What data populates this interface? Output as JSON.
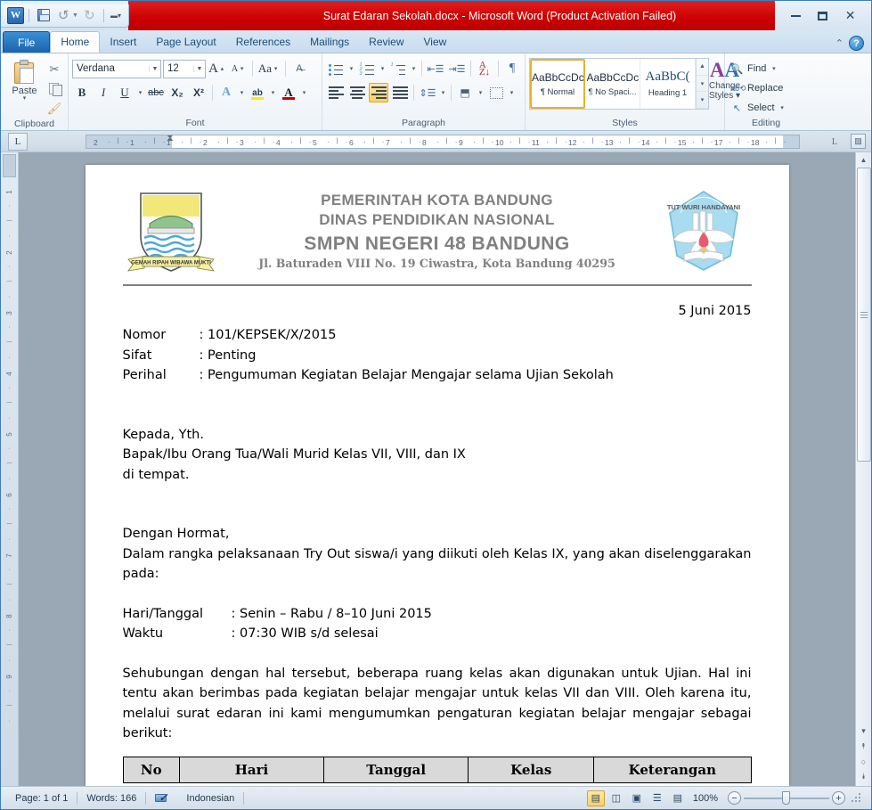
{
  "window": {
    "title": "Surat Edaran Sekolah.docx  -  Microsoft Word (Product Activation Failed)",
    "app_logo": "W",
    "controls": {
      "minimize": "minimize-icon",
      "maximize": "maximize-icon",
      "close": "✕"
    }
  },
  "quick_access": {
    "items": [
      {
        "name": "save-icon",
        "label": "Save"
      },
      {
        "name": "undo-icon",
        "label": "↺"
      },
      {
        "name": "redo-icon",
        "label": "↻"
      },
      {
        "name": "customize-qat-icon",
        "label": "▾"
      }
    ]
  },
  "tabs": [
    {
      "label": "File",
      "active": false,
      "file": true
    },
    {
      "label": "Home",
      "active": true
    },
    {
      "label": "Insert",
      "active": false
    },
    {
      "label": "Page Layout",
      "active": false
    },
    {
      "label": "References",
      "active": false
    },
    {
      "label": "Mailings",
      "active": false
    },
    {
      "label": "Review",
      "active": false
    },
    {
      "label": "View",
      "active": false
    }
  ],
  "tabbar_right": {
    "minimize_ribbon": "⌃",
    "help": "?"
  },
  "ribbon": {
    "clipboard": {
      "label": "Clipboard",
      "paste": "Paste",
      "paste_arrow": "▾",
      "cut": "✂",
      "copy": "copy-icon",
      "format_painter": "🖌",
      "launcher": "⌍"
    },
    "font": {
      "label": "Font",
      "font_name": "Verdana",
      "font_size": "12",
      "grow_font": "A",
      "shrink_font": "A",
      "change_case": "Aa",
      "clear_formatting": "clear-formatting-icon",
      "bold": "B",
      "italic": "I",
      "underline": "U",
      "strikethrough": "abc",
      "subscript": "X₂",
      "superscript": "X²",
      "text_effects": "A",
      "highlight": "ab",
      "font_color": "A",
      "launcher": "⌍"
    },
    "paragraph": {
      "label": "Paragraph",
      "bullets": "bullets-icon",
      "numbering": "numbering-icon",
      "multilevel": "multilevel-list-icon",
      "decrease_indent": "decrease-indent-icon",
      "increase_indent": "increase-indent-icon",
      "sort": "sort-icon",
      "show_marks": "¶",
      "align_left": "align-left-icon",
      "align_center": "align-center-icon",
      "align_right": "align-right-icon",
      "justify": "justify-icon",
      "line_spacing": "line-spacing-icon",
      "shading": "shading-icon",
      "borders": "borders-icon",
      "launcher": "⌍"
    },
    "styles": {
      "label": "Styles",
      "items": [
        {
          "preview": "AaBbCcDc",
          "name": "¶ Normal",
          "selected": true
        },
        {
          "preview": "AaBbCcDc",
          "name": "¶ No Spaci...",
          "selected": false
        },
        {
          "preview": "AaBbC(",
          "name": "Heading 1",
          "selected": false
        }
      ],
      "scroll_up": "▲",
      "scroll_down": "▾",
      "more": "▾",
      "change_styles": "Change",
      "change_styles2": "Styles ▾",
      "launcher": "⌍"
    },
    "editing": {
      "label": "Editing",
      "find": "Find",
      "find_arrow": "▾",
      "replace": "Replace",
      "select": "Select",
      "select_arrow": "▾"
    }
  },
  "ruler": {
    "tab_selector": "L",
    "horizontal_marks": [
      "2",
      "1",
      "1",
      "2",
      "3",
      "4",
      "5",
      "6",
      "7",
      "8",
      "9",
      "10",
      "11",
      "12",
      "13",
      "14",
      "15",
      "17",
      "18"
    ],
    "vertical_marks": [
      "1",
      "2",
      "3",
      "4",
      "5",
      "6",
      "7",
      "8",
      "9"
    ],
    "right_tab_icon": "L",
    "far_icon": "select-browse-object-icon"
  },
  "document": {
    "letterhead": {
      "logo_left": "bandung-city-seal-logo",
      "logo_left_motto": "GEMAH RIPAH WIBAWA MUKTI",
      "logo_right": "tut-wuri-handayani-logo",
      "logo_right_text": "TUT WURI HANDAYANI",
      "line1": "PEMERINTAH KOTA BANDUNG",
      "line2": "DINAS PENDIDIKAN NASIONAL",
      "line3": "SMPN NEGERI 48 BANDUNG",
      "line4": "Jl. Baturaden VIII No. 19 Ciwastra, Kota Bandung 40295"
    },
    "date": "5 Juni 2015",
    "fields": [
      {
        "key": "Nomor",
        "value": ": 101/KEPSEK/X/2015"
      },
      {
        "key": "Sifat",
        "value": ": Penting"
      },
      {
        "key": "Perihal",
        "value": ": Pengumuman Kegiatan Belajar Mengajar selama Ujian Sekolah"
      }
    ],
    "addressee": [
      "Kepada, Yth.",
      "Bapak/Ibu Orang Tua/Wali Murid Kelas VII, VIII, dan IX",
      "di tempat."
    ],
    "salutation": "Dengan Hormat,",
    "body1": "Dalam rangka pelaksanaan Try Out siswa/i yang diikuti oleh Kelas IX, yang akan diselenggarakan pada:",
    "details": [
      {
        "key": "Hari/Tanggal",
        "value": ": Senin – Rabu / 8–10 Juni 2015"
      },
      {
        "key": "Waktu",
        "value": ": 07:30 WIB s/d selesai"
      }
    ],
    "body2": "Sehubungan dengan hal tersebut, beberapa ruang kelas akan digunakan untuk Ujian. Hal ini tentu akan berimbas pada kegiatan belajar mengajar untuk kelas VII dan VIII. Oleh karena itu, melalui surat edaran ini kami mengumumkan pengaturan kegiatan belajar mengajar sebagai berikut:",
    "table": {
      "headers": [
        "No",
        "Hari",
        "Tanggal",
        "Kelas",
        "Keterangan"
      ]
    }
  },
  "scrollbar": {
    "up": "▲",
    "down": "▾",
    "prev_page": "⯭",
    "browse_object": "○",
    "next_page": "⯯"
  },
  "status": {
    "page": "Page: 1 of 1",
    "words": "Words: 166",
    "proofing_icon": "proofing-errors-icon",
    "language": "Indonesian",
    "views": [
      {
        "name": "print-layout-view",
        "glyph": "▤",
        "active": true
      },
      {
        "name": "full-screen-reading-view",
        "glyph": "◫",
        "active": false
      },
      {
        "name": "web-layout-view",
        "glyph": "▣",
        "active": false
      },
      {
        "name": "outline-view",
        "glyph": "☰",
        "active": false
      },
      {
        "name": "draft-view",
        "glyph": "▤",
        "active": false
      }
    ],
    "zoom": "100%",
    "zoom_out": "−",
    "zoom_in": "+"
  },
  "colors": {
    "titlebar_red": "#cc0000",
    "accent_blue": "#1b64ad",
    "selection_gold": "#e8b02e",
    "letterhead_gray": "#808080"
  }
}
